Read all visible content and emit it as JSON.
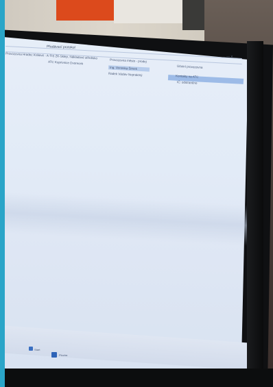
{
  "window": {
    "title": "Předávací protokol",
    "controls": "—  ×"
  },
  "table": {
    "row1": {
      "col_a": "Provozovna Hradec Králové - A-TIS ZK-Sklep, Nákladové středisko",
      "col_b": "Provozovna město - prodej",
      "col_c": "Účetní provozovna"
    },
    "row2": {
      "col_a": "ATC Koprivnice Dvorecek",
      "col_b": "Ing. Veronika Šimek",
      "col_c": "Kontakty na ATC"
    },
    "row3": {
      "col_b": "Radek Václav Nepraktný",
      "col_c": "IČ: odstraněno"
    }
  },
  "taskbar": {
    "item1": "Start",
    "item2": "Plocha",
    "clock": "Novinky"
  }
}
